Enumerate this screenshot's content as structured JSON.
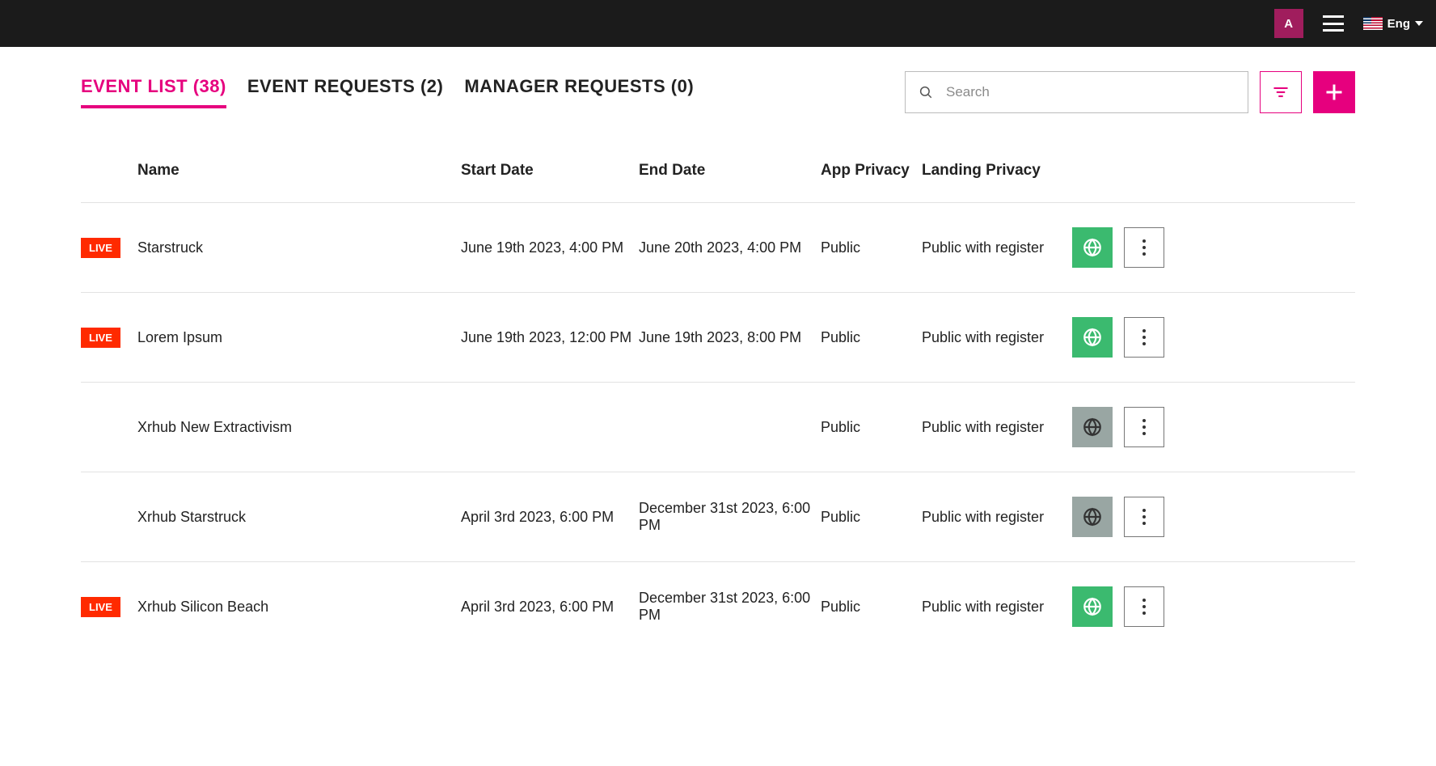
{
  "header": {
    "avatar_initial": "A",
    "language_label": "Eng"
  },
  "tabs": [
    {
      "label": "EVENT LIST (38)",
      "active": true
    },
    {
      "label": "EVENT REQUESTS (2)",
      "active": false
    },
    {
      "label": "MANAGER REQUESTS (0)",
      "active": false
    }
  ],
  "search": {
    "placeholder": "Search",
    "value": ""
  },
  "columns": {
    "name": "Name",
    "start_date": "Start Date",
    "end_date": "End Date",
    "app_privacy": "App Privacy",
    "landing_privacy": "Landing Privacy"
  },
  "live_label": "LIVE",
  "rows": [
    {
      "live": true,
      "name": "Starstruck",
      "start": "June 19th 2023, 4:00 PM",
      "end": "June 20th 2023, 4:00 PM",
      "app_privacy": "Public",
      "landing_privacy": "Public with register",
      "globe": "green"
    },
    {
      "live": true,
      "name": "Lorem Ipsum",
      "start": "June 19th 2023, 12:00 PM",
      "end": "June 19th 2023, 8:00 PM",
      "app_privacy": "Public",
      "landing_privacy": "Public with register",
      "globe": "green"
    },
    {
      "live": false,
      "name": "Xrhub New Extractivism",
      "start": "",
      "end": "",
      "app_privacy": "Public",
      "landing_privacy": "Public with register",
      "globe": "grey"
    },
    {
      "live": false,
      "name": "Xrhub Starstruck",
      "start": "April 3rd 2023, 6:00 PM",
      "end": "December 31st 2023, 6:00 PM",
      "app_privacy": "Public",
      "landing_privacy": "Public with register",
      "globe": "grey"
    },
    {
      "live": true,
      "name": "Xrhub Silicon Beach",
      "start": "April 3rd 2023, 6:00 PM",
      "end": "December 31st 2023, 6:00 PM",
      "app_privacy": "Public",
      "landing_privacy": "Public with register",
      "globe": "green"
    }
  ]
}
